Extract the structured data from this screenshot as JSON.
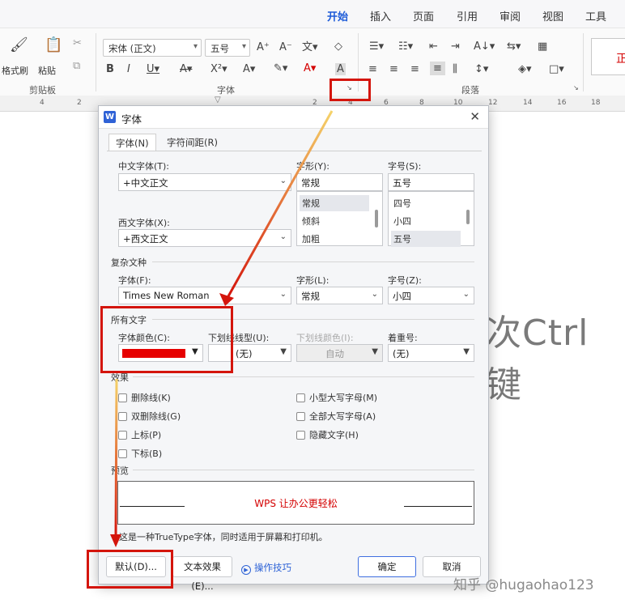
{
  "ribbon": {
    "tabs": [
      "开始",
      "插入",
      "页面",
      "引用",
      "审阅",
      "视图",
      "工具"
    ],
    "active_tab": "开始",
    "clipboard": {
      "format_painter": "格式刷",
      "paste": "粘贴",
      "group_label": "剪贴板"
    },
    "font": {
      "font_name": "宋体 (正文)",
      "font_size": "五号",
      "group_label": "字体"
    },
    "paragraph": {
      "group_label": "段落"
    },
    "style_preview": "正"
  },
  "ruler": {
    "numbers": [
      "4",
      "2",
      "2",
      "4",
      "6",
      "8",
      "10",
      "12",
      "14",
      "16",
      "18"
    ]
  },
  "document": {
    "visible_text": "次Ctrl键"
  },
  "dialog": {
    "title": "字体",
    "tabs": [
      "字体(N)",
      "字符间距(R)"
    ],
    "chinese_font": {
      "label": "中文字体(T):",
      "value": "+中文正文"
    },
    "western_font": {
      "label": "西文字体(X):",
      "value": "+西文正文"
    },
    "style": {
      "label": "字形(Y):",
      "value": "常规",
      "options": [
        "常规",
        "倾斜",
        "加粗"
      ]
    },
    "size": {
      "label": "字号(S):",
      "value": "五号",
      "options": [
        "四号",
        "小四",
        "五号"
      ]
    },
    "complex": {
      "section": "复杂文种",
      "font_label": "字体(F):",
      "font_value": "Times New Roman",
      "style_label": "字形(L):",
      "style_value": "常规",
      "size_label": "字号(Z):",
      "size_value": "小四"
    },
    "all_text": {
      "section": "所有文字",
      "color_label": "字体颜色(C):",
      "color_value": "#e60000",
      "underline_label": "下划线线型(U):",
      "underline_value": "(无)",
      "underline_color_label": "下划线颜色(I):",
      "underline_color_value": "自动",
      "emphasis_label": "着重号:",
      "emphasis_value": "(无)"
    },
    "effects": {
      "section": "效果",
      "left": [
        "删除线(K)",
        "双删除线(G)",
        "上标(P)",
        "下标(B)"
      ],
      "right": [
        "小型大写字母(M)",
        "全部大写字母(A)",
        "隐藏文字(H)"
      ]
    },
    "preview": {
      "section": "预览",
      "text": "WPS 让办公更轻松"
    },
    "info": "这是一种TrueType字体，同时适用于屏幕和打印机。",
    "buttons": {
      "default": "默认(D)...",
      "text_effects": "文本效果(E)...",
      "tips": "操作技巧",
      "ok": "确定",
      "cancel": "取消"
    }
  },
  "watermark": "知乎 @hugaohao123",
  "colors": {
    "annotation": "#d4150c",
    "accent": "#1d5bd8"
  }
}
